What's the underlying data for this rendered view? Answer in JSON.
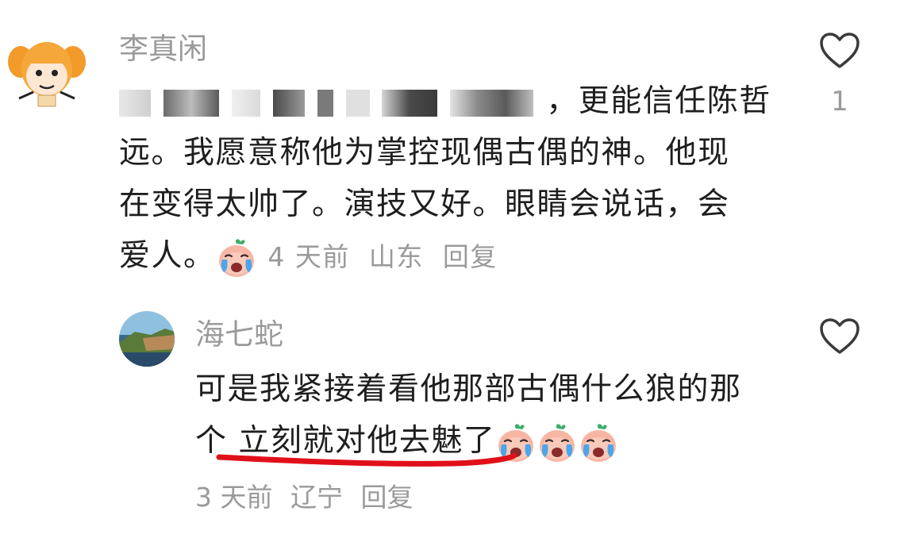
{
  "comments": [
    {
      "username": "李真闲",
      "text_visible_tail": "，更能信任陈哲",
      "text_lines": [
        "远。我愿意称他为掌控现偶古偶的神。他现",
        "在变得太帅了。演技又好。眼睛会说话，会",
        "爱人。"
      ],
      "emoji": "crying-emoji",
      "time": "4 天前",
      "location": "山东",
      "reply_label": "回复",
      "like_count": "1"
    },
    {
      "username": "海七蛇",
      "text_lines": [
        "可是我紧接着看他那部古偶什么狼的那",
        "个 立刻就对他去魅了"
      ],
      "emojis": [
        "crying-emoji",
        "crying-emoji",
        "crying-emoji"
      ],
      "time": "3 天前",
      "location": "辽宁",
      "reply_label": "回复",
      "like_count": ""
    }
  ],
  "colors": {
    "meta_gray": "#9a9a9a",
    "text": "#1e1e1e",
    "highlight_underline": "#e0101a"
  },
  "icons": {
    "like": "heart-outline-icon"
  }
}
